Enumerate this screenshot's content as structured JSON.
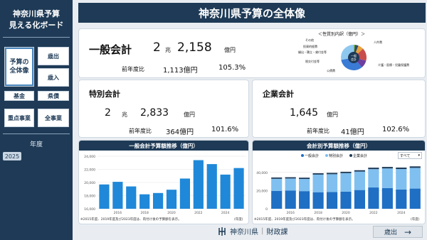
{
  "sidebar": {
    "title_line1": "神奈川県予算",
    "title_line2": "見える化ボード",
    "btn_overview_line1": "予算の",
    "btn_overview_line2": "全体像",
    "btn_expenditure": "歳出",
    "btn_revenue": "歳入",
    "btn_fund": "基金",
    "btn_debt": "県債",
    "btn_priority": "重点事業",
    "btn_all": "全事業",
    "year_label": "年度",
    "year_value": "2025"
  },
  "header": {
    "title": "神奈川県予算の全体像"
  },
  "general": {
    "label": "一般会計",
    "amount_cho_num": "2",
    "amount_cho_unit": "兆",
    "amount_oku_num": "2,158",
    "amount_oku_unit": "億円",
    "yoy_label": "前年度比",
    "yoy_diff": "1,113億円",
    "yoy_pct": "105.3%",
    "pie_title": "＜性質別内訳（億円）＞",
    "pie_center_line1": "一般",
    "pie_center_line2": "会計",
    "pie_labels": [
      "その他",
      "投資的経費",
      "繰出・積立・貸付金等",
      "税交付金等",
      "公債費",
      "人件費",
      "介護・医療・児童保護費"
    ]
  },
  "special": {
    "label": "特別会計",
    "amount_cho_num": "2",
    "amount_cho_unit": "兆",
    "amount_oku_num": "2,833",
    "amount_oku_unit": "億円",
    "yoy_label": "前年度比",
    "yoy_diff": "364億円",
    "yoy_pct": "101.6%"
  },
  "enterprise": {
    "label": "企業会計",
    "amount_oku_num": "1,645",
    "amount_oku_unit": "億円",
    "yoy_label": "前年度比",
    "yoy_diff": "41億円",
    "yoy_pct": "102.6%"
  },
  "chart_data": [
    {
      "type": "bar",
      "title": "一般会計予算額推移（億円）",
      "categories": [
        "2015",
        "2016",
        "2017",
        "2018",
        "2019",
        "2020",
        "2021",
        "2022",
        "2023",
        "2024",
        "2025"
      ],
      "x_tick_labels": [
        "2016",
        "2018",
        "2020",
        "2022",
        "2024"
      ],
      "values": [
        19700,
        20100,
        19400,
        18200,
        18400,
        18900,
        20600,
        23400,
        22800,
        21200,
        22200
      ],
      "ylim": [
        16000,
        24000
      ],
      "y_ticks": [
        "16,000",
        "18,000",
        "20,000",
        "22,000",
        "24,000"
      ],
      "color": "#1f88d8",
      "note": "※2015年度、2019年度及び2023年度は、肉付け後の予算額を表示。",
      "axis_note": "(年度)"
    },
    {
      "type": "bar",
      "stacked": true,
      "title": "会計別予算額推移（億円）",
      "categories": [
        "2015",
        "2016",
        "2017",
        "2018",
        "2019",
        "2020",
        "2021",
        "2022",
        "2023",
        "2024",
        "2025"
      ],
      "x_tick_labels": [
        "2016",
        "2018",
        "2020",
        "2022",
        "2024"
      ],
      "series": [
        {
          "name": "一般会計",
          "values": [
            19700,
            20100,
            19400,
            18200,
            18400,
            18900,
            20600,
            23400,
            22800,
            21200,
            22200
          ],
          "color": "#1f6fc4"
        },
        {
          "name": "特別会計",
          "values": [
            13300,
            13200,
            13400,
            19400,
            19600,
            20300,
            20300,
            20200,
            21600,
            22500,
            22800
          ],
          "color": "#7fc0f0"
        },
        {
          "name": "企業会計",
          "values": [
            1400,
            1400,
            1400,
            1500,
            1500,
            1500,
            1500,
            1600,
            1600,
            1600,
            1645
          ],
          "color": "#1e3a56"
        }
      ],
      "ylim": [
        0,
        50000
      ],
      "y_ticks": [
        "0",
        "20,000",
        "40,000"
      ],
      "dropdown_value": "すべて",
      "note": "※2015年度、2019年度及び2023年度は、肉付け後の予算額を表示。",
      "axis_note": "(年度)"
    }
  ],
  "pie": {
    "values": [
      1.5,
      4.5,
      7,
      16,
      10,
      33,
      28
    ],
    "colors": [
      "#7ac142",
      "#2b4a6b",
      "#e8a33c",
      "#c94c4c",
      "#6c3fa0",
      "#3a7bd5",
      "#8fc8ee"
    ]
  },
  "footer": {
    "logo_text": "神奈川県",
    "dept_text": "財政課",
    "next_label": "歳出",
    "next_arrow": "→"
  }
}
